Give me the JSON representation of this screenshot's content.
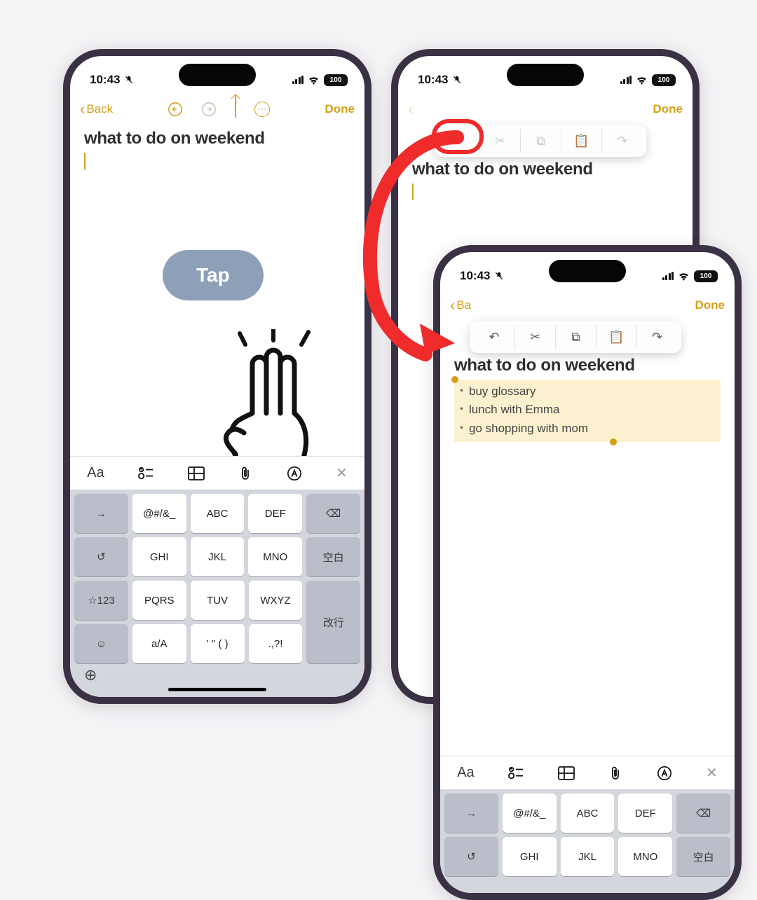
{
  "status": {
    "time": "10:43",
    "battery": "100"
  },
  "nav": {
    "back": "Back",
    "done": "Done",
    "back_short": "Ba"
  },
  "note": {
    "title": "what to do on weekend",
    "items": [
      "buy glossary",
      "lunch with Emma",
      "go shopping with mom"
    ]
  },
  "overlay": {
    "tap": "Tap"
  },
  "fmt": {
    "aa": "Aa",
    "close": "✕"
  },
  "keyboard": {
    "tab": "→",
    "row1": [
      "@#/&_",
      "ABC",
      "DEF"
    ],
    "del": "⌫",
    "undo": "↺",
    "row2": [
      "GHI",
      "JKL",
      "MNO"
    ],
    "space": "空白",
    "sym": "☆123",
    "row3": [
      "PQRS",
      "TUV",
      "WXYZ"
    ],
    "enter": "改行",
    "emoji": "☺",
    "row4": [
      "a/A",
      "' \" ( )",
      ".,?!"
    ],
    "globe": "⊕"
  },
  "editmenu": {
    "undo": "↶",
    "cut": "✂",
    "copy": "⧉",
    "paste": "📋",
    "redo": "↷"
  }
}
